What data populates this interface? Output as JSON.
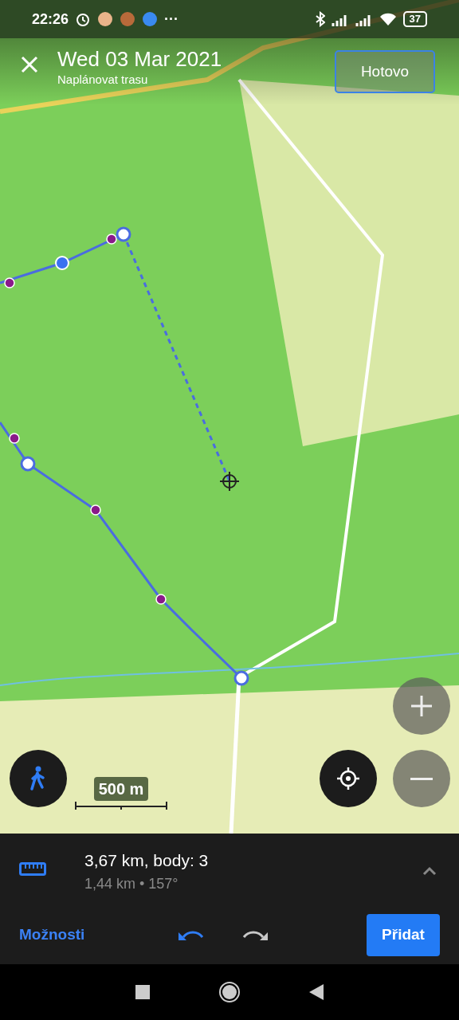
{
  "status_bar": {
    "time": "22:26",
    "more": "···",
    "battery": "37"
  },
  "header": {
    "title": "Wed 03 Mar 2021",
    "subtitle": "Naplánovat trasu",
    "done_button": "Hotovo"
  },
  "map": {
    "scale": "500 m"
  },
  "panel": {
    "distance": "3,67 km, body: 3",
    "detail": "1,44 km • 157°",
    "options_button": "Možnosti",
    "undo": {
      "disabled": false
    },
    "redo": {
      "disabled": true
    },
    "add_button": "Přidat"
  }
}
